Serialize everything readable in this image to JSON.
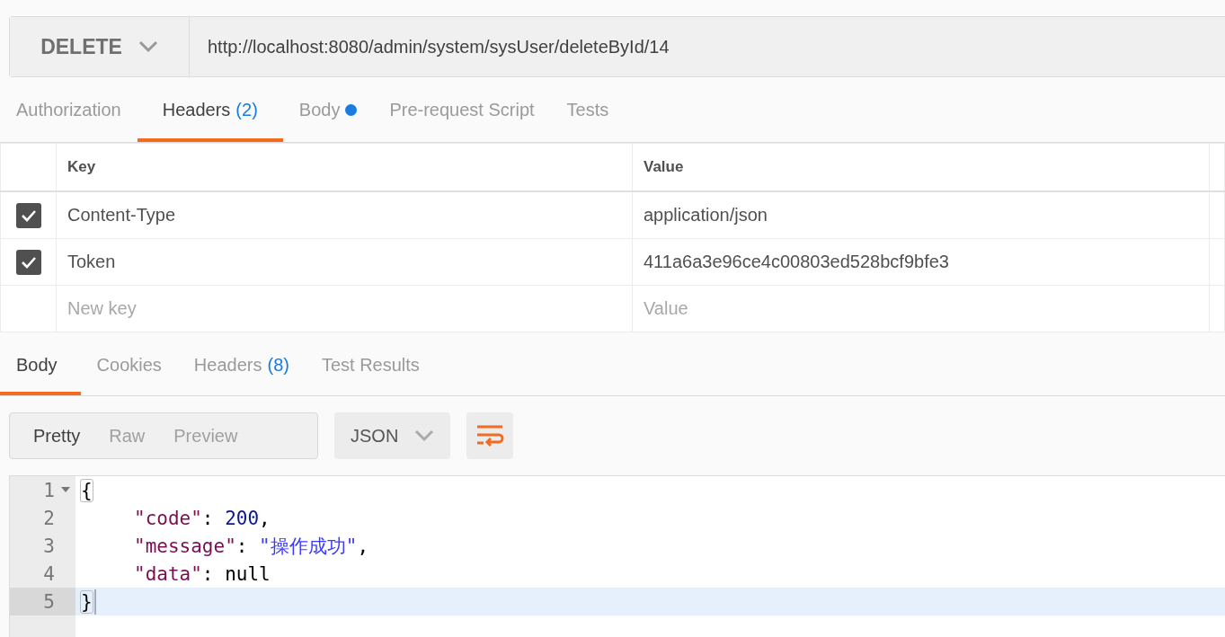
{
  "request": {
    "method": "DELETE",
    "url": "http://localhost:8080/admin/system/sysUser/deleteById/14"
  },
  "request_tabs": [
    {
      "label": "Authorization",
      "dot": false,
      "selected": false
    },
    {
      "label": "Headers",
      "count": "(2)",
      "dot": false,
      "selected": true
    },
    {
      "label": "Body",
      "dot": true,
      "selected": false
    },
    {
      "label": "Pre-request Script",
      "dot": false,
      "selected": false
    },
    {
      "label": "Tests",
      "dot": false,
      "selected": false
    }
  ],
  "headers_table": {
    "columns": [
      "Key",
      "Value"
    ],
    "rows": [
      {
        "checked": true,
        "key": "Content-Type",
        "value": "application/json"
      },
      {
        "checked": true,
        "key": "Token",
        "value": "411a6a3e96ce4c00803ed528bcf9bfe3"
      }
    ],
    "new_row": {
      "key_placeholder": "New key",
      "value_placeholder": "Value"
    }
  },
  "response_tabs": [
    {
      "label": "Body",
      "selected": true
    },
    {
      "label": "Cookies",
      "selected": false
    },
    {
      "label": "Headers",
      "count": "(8)",
      "selected": false
    },
    {
      "label": "Test Results",
      "selected": false
    }
  ],
  "view_modes": [
    {
      "label": "Pretty",
      "selected": true
    },
    {
      "label": "Raw",
      "selected": false
    },
    {
      "label": "Preview",
      "selected": false
    }
  ],
  "format": "JSON",
  "code_lines": [
    {
      "number": "1",
      "foldable": true,
      "indented": false,
      "active": false,
      "tokens": [
        {
          "kind": "punct",
          "text": "{",
          "matched": true
        }
      ]
    },
    {
      "number": "2",
      "foldable": false,
      "indented": true,
      "active": false,
      "tokens": [
        {
          "kind": "key",
          "text": "\"code\"",
          "matched": false
        },
        {
          "kind": "punct",
          "text": ": ",
          "matched": false
        },
        {
          "kind": "number",
          "text": "200",
          "matched": false
        },
        {
          "kind": "punct",
          "text": ",",
          "matched": false
        }
      ]
    },
    {
      "number": "3",
      "foldable": false,
      "indented": true,
      "active": false,
      "tokens": [
        {
          "kind": "key",
          "text": "\"message\"",
          "matched": false
        },
        {
          "kind": "punct",
          "text": ": ",
          "matched": false
        },
        {
          "kind": "string",
          "text": "\"操作成功\"",
          "matched": false
        },
        {
          "kind": "punct",
          "text": ",",
          "matched": false
        }
      ]
    },
    {
      "number": "4",
      "foldable": false,
      "indented": true,
      "active": false,
      "tokens": [
        {
          "kind": "key",
          "text": "\"data\"",
          "matched": false
        },
        {
          "kind": "punct",
          "text": ": ",
          "matched": false
        },
        {
          "kind": "null",
          "text": "null",
          "matched": false
        }
      ]
    },
    {
      "number": "5",
      "foldable": false,
      "indented": false,
      "active": true,
      "tokens": [
        {
          "kind": "punct",
          "text": "}",
          "matched": true
        }
      ]
    }
  ]
}
